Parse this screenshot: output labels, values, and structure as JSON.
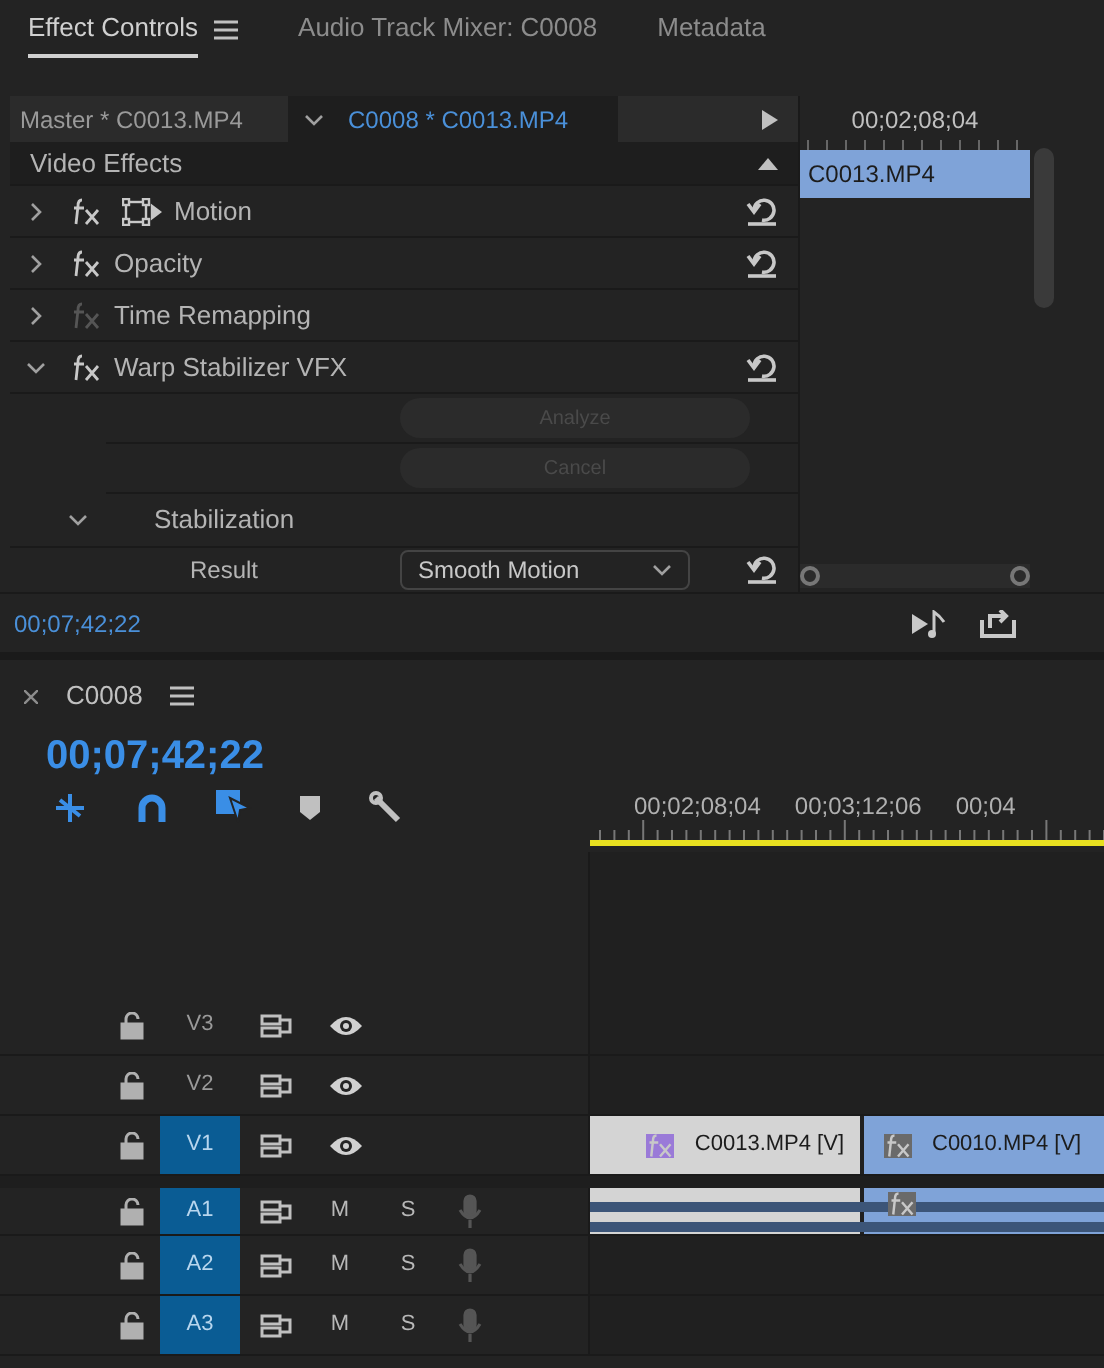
{
  "panel_tabs": [
    {
      "label": "Effect Controls",
      "selected": true,
      "menu": true
    },
    {
      "label": "Audio Track Mixer: C0008",
      "selected": false,
      "menu": false
    },
    {
      "label": "Metadata",
      "selected": false,
      "menu": false
    }
  ],
  "effect_controls": {
    "master_label": "Master * C0013.MP4",
    "clip_label": "C0008 * C0013.MP4",
    "mini_timecode": "00;02;08;04",
    "mini_clip": "C0013.MP4",
    "section": "Video Effects",
    "rows": [
      {
        "kind": "effect",
        "label": "Motion",
        "expanded": false,
        "enabled": true,
        "transform_icon": true,
        "reset": true
      },
      {
        "kind": "effect",
        "label": "Opacity",
        "expanded": false,
        "enabled": true,
        "reset": true
      },
      {
        "kind": "effect",
        "label": "Time Remapping",
        "expanded": false,
        "enabled": false
      },
      {
        "kind": "effect",
        "label": "Warp Stabilizer VFX",
        "expanded": true,
        "enabled": true,
        "reset": true
      },
      {
        "kind": "button",
        "label": "Analyze",
        "disabled": true
      },
      {
        "kind": "button",
        "label": "Cancel",
        "disabled": true
      },
      {
        "kind": "group",
        "label": "Stabilization",
        "expanded": true
      },
      {
        "kind": "param",
        "label": "Result",
        "value": "Smooth Motion",
        "reset": true
      }
    ],
    "timecode": "00;07;42;22"
  },
  "timeline": {
    "sequence": "C0008",
    "timecode": "00;07;42;22",
    "ruler_labels": [
      "00;02;08;04",
      "00;03;12;06",
      "00;04"
    ],
    "tracks": [
      {
        "kind": "video",
        "name": "V3",
        "targeted": false
      },
      {
        "kind": "video",
        "name": "V2",
        "targeted": false
      },
      {
        "kind": "video",
        "name": "V1",
        "targeted": true,
        "clips": [
          {
            "label": "C0013.MP4 [V]",
            "color": "#d4d4d4",
            "fx_applied": true
          },
          {
            "label": "C0010.MP4 [V]",
            "color": "#7fa3d8",
            "fx_applied": false
          }
        ]
      },
      {
        "kind": "audio",
        "name": "A1",
        "targeted": true,
        "mute": "M",
        "solo": "S",
        "clips": [
          {
            "color": "#d4d4d4"
          },
          {
            "color": "#7fa3d8",
            "fx_badge": true
          }
        ]
      },
      {
        "kind": "audio",
        "name": "A2",
        "targeted": true,
        "mute": "M",
        "solo": "S"
      },
      {
        "kind": "audio",
        "name": "A3",
        "targeted": true,
        "mute": "M",
        "solo": "S"
      }
    ]
  }
}
